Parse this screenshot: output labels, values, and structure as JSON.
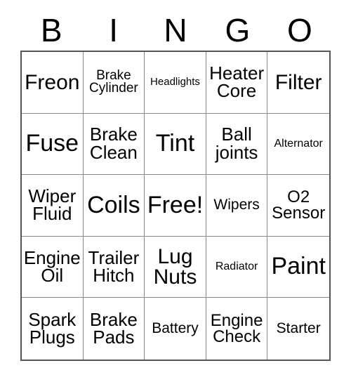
{
  "header": {
    "letters": [
      "B",
      "I",
      "N",
      "G",
      "O"
    ]
  },
  "grid": {
    "rows": 5,
    "columns": 5,
    "cells": [
      {
        "label": "Freon",
        "size": "fs-2xl"
      },
      {
        "label": "Brake\nCylinder",
        "size": "fs-m"
      },
      {
        "label": "Headlights",
        "size": "fs-xs"
      },
      {
        "label": "Heater\nCore",
        "size": "fs-xl"
      },
      {
        "label": "Filter",
        "size": "fs-2xl"
      },
      {
        "label": "Fuse",
        "size": "fs-3xl"
      },
      {
        "label": "Brake\nClean",
        "size": "fs-xl"
      },
      {
        "label": "Tint",
        "size": "fs-3xl"
      },
      {
        "label": "Ball\njoints",
        "size": "fs-xl"
      },
      {
        "label": "Alternator",
        "size": "fs-s"
      },
      {
        "label": "Wiper\nFluid",
        "size": "fs-xl"
      },
      {
        "label": "Coils",
        "size": "fs-3xl"
      },
      {
        "label": "Free!",
        "size": "fs-3xl"
      },
      {
        "label": "Wipers",
        "size": "fs-ml"
      },
      {
        "label": "O2\nSensor",
        "size": "fs-l"
      },
      {
        "label": "Engine\nOil",
        "size": "fs-xl"
      },
      {
        "label": "Trailer\nHitch",
        "size": "fs-xl"
      },
      {
        "label": "Lug\nNuts",
        "size": "fs-2xl"
      },
      {
        "label": "Radiator",
        "size": "fs-s"
      },
      {
        "label": "Paint",
        "size": "fs-3xl"
      },
      {
        "label": "Spark\nPlugs",
        "size": "fs-xl"
      },
      {
        "label": "Brake\nPads",
        "size": "fs-xl"
      },
      {
        "label": "Battery",
        "size": "fs-ml"
      },
      {
        "label": "Engine\nCheck",
        "size": "fs-l"
      },
      {
        "label": "Starter",
        "size": "fs-ml"
      }
    ]
  },
  "colors": {
    "background": "#ffffff",
    "text": "#000000",
    "outer_border": "#555555",
    "inner_border": "#888888"
  }
}
